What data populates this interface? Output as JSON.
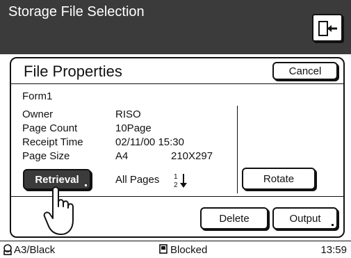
{
  "app": {
    "title": "Storage File Selection"
  },
  "panel": {
    "title": "File Properties",
    "cancel_label": "Cancel",
    "file_name": "Form1",
    "properties": [
      {
        "label": "Owner",
        "value": "RISO"
      },
      {
        "label": "Page Count",
        "value": "10Page"
      },
      {
        "label": "Receipt Time",
        "value": "02/11/00 15:30"
      },
      {
        "label": "Page Size",
        "value": "A4",
        "extra": "210X297"
      }
    ],
    "retrieval_label": "Retrieval",
    "all_pages_label": "All Pages",
    "rotate_label": "Rotate",
    "delete_label": "Delete",
    "output_label": "Output"
  },
  "status": {
    "paper": "A3/Black",
    "state": "Blocked",
    "time": "13:59"
  },
  "icons": {
    "exit": "exit-door-icon",
    "page_order": "page-order-icon",
    "pointer": "hand-pointer-icon",
    "drum": "drum-icon",
    "blocked": "blocked-icon"
  }
}
